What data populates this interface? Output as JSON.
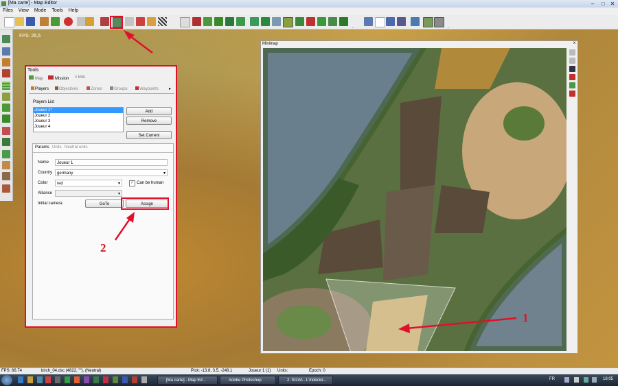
{
  "window": {
    "title": "[Ma carte] - Map Editor",
    "min": "–",
    "max": "□",
    "close": "✕"
  },
  "menu": [
    "Files",
    "View",
    "Mode",
    "Tools",
    "Help"
  ],
  "map": {
    "fps_overlay": "FPS: 26,5"
  },
  "tools": {
    "title": "Tools",
    "top_tabs": [
      "Map",
      "Mission",
      "Info"
    ],
    "sub_tabs": [
      "Players",
      "Objectives",
      "Zones",
      "Groups",
      "Waypoints"
    ],
    "players_list_label": "Players List",
    "players": [
      "Joueur 1*",
      "Joueur 2",
      "Joueur 3",
      "Joueur 4"
    ],
    "buttons": {
      "add": "Add",
      "remove": "Remove",
      "set_current": "Set Current"
    },
    "params_tabs": [
      "Params",
      "Units",
      "Neutral units"
    ],
    "name_label": "Name",
    "name_value": "Joueur 1",
    "country_label": "Country",
    "country_value": "germany",
    "color_label": "Color",
    "color_value": "red",
    "can_be_human": "Can be human",
    "alliance_label": "Alliance",
    "initial_camera_label": "Initial camera",
    "goto": "GoTo",
    "assign": "Assign"
  },
  "minimap": {
    "title": "Minimap",
    "close": "x"
  },
  "annotations": {
    "one": "1",
    "two": "2"
  },
  "status": {
    "fps": "FPS: 66.74",
    "object": "birch_04.dsc (4822, \"\"), (Neutral)",
    "pick": "Pick: -13.8, 3.5, -248.1",
    "player": "Joueur 1 (1)",
    "units": "Units:",
    "epoch": "Epoch: 0"
  },
  "taskbar": {
    "tasks": [
      "[Ma carte] - Map Ed...",
      "Adobe Photoshop",
      "2. SILVA - L'indécisi..."
    ],
    "lang": "FR",
    "time": "18:05"
  },
  "colors": {
    "highlight": "#e0102a",
    "selection": "#3399ff"
  }
}
